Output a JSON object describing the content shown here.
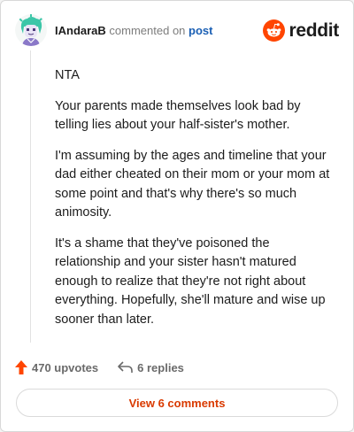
{
  "header": {
    "username": "IAndaraB",
    "action_text": "commented on",
    "post_link": "post",
    "brand_name": "reddit"
  },
  "comment": {
    "paragraphs": [
      "NTA",
      "Your parents made themselves look bad by telling lies about your half-sister's mother.",
      "I'm assuming by the ages and timeline that your dad either cheated on their mom or your mom at some point and that's why there's so much animosity.",
      "It's a shame that they've poisoned the relationship and your sister hasn't matured enough to realize that they're not right about everything. Hopefully, she'll mature and wise up sooner than later."
    ]
  },
  "stats": {
    "upvotes": "470 upvotes",
    "replies": "6 replies"
  },
  "actions": {
    "view_comments_label": "View 6 comments"
  },
  "icons": {
    "upvote": "upvote-arrow-icon",
    "reply": "reply-arrow-icon",
    "brand": "reddit-snoo-logo-icon",
    "avatar": "user-avatar-icon"
  },
  "colors": {
    "reddit_orange": "#ff4500",
    "upvote_orange": "#ff4500",
    "view_button_text": "#d93a00",
    "post_link_blue": "#1a5fb4"
  }
}
